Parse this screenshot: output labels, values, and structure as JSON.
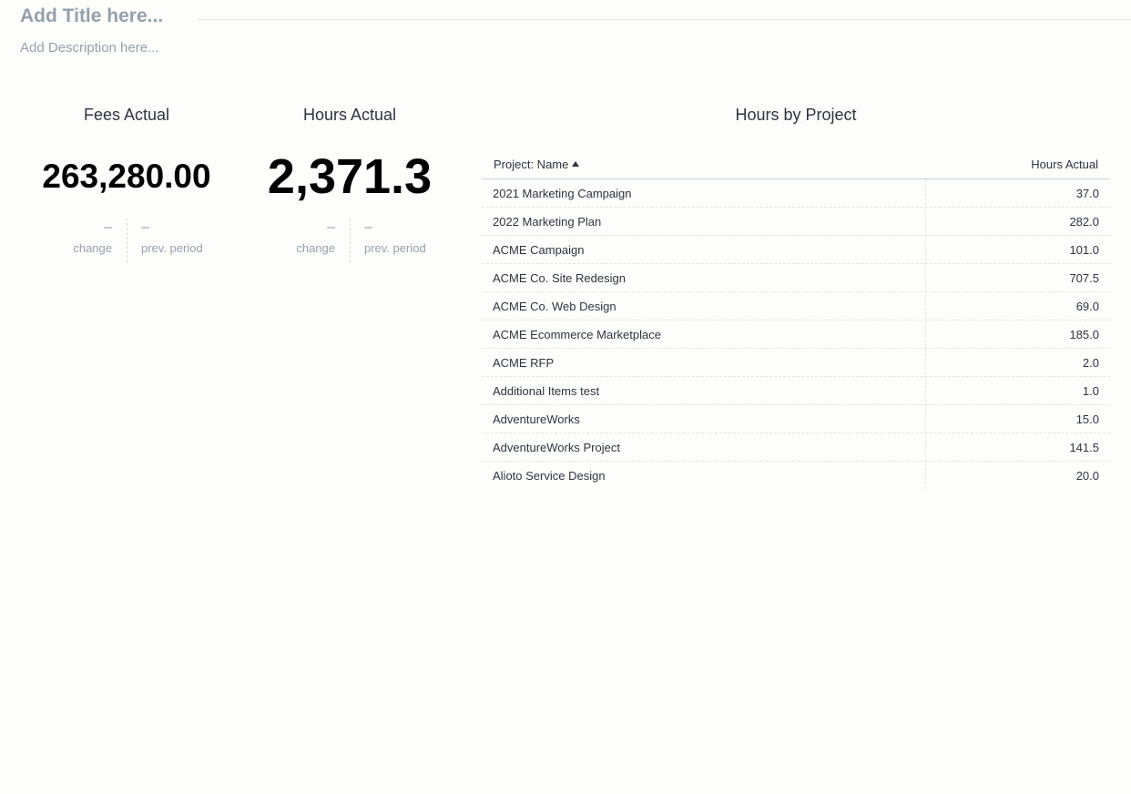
{
  "dashboard": {
    "title_placeholder": "Add Title here...",
    "description_placeholder": "Add Description here..."
  },
  "kpis": [
    {
      "title": "Fees Actual",
      "value": "263,280.00",
      "change_value": "–",
      "change_label": "change",
      "prev_value": "–",
      "prev_label": "prev. period"
    },
    {
      "title": "Hours Actual",
      "value": "2,371.3",
      "change_value": "–",
      "change_label": "change",
      "prev_value": "–",
      "prev_label": "prev. period"
    }
  ],
  "table": {
    "title": "Hours by Project",
    "columns": [
      "Project: Name",
      "Hours Actual"
    ],
    "rows": [
      {
        "name": "2021 Marketing Campaign",
        "value": "37.0"
      },
      {
        "name": "2022 Marketing Plan",
        "value": "282.0"
      },
      {
        "name": "ACME Campaign",
        "value": "101.0"
      },
      {
        "name": "ACME Co. Site Redesign",
        "value": "707.5"
      },
      {
        "name": "ACME Co. Web Design",
        "value": "69.0"
      },
      {
        "name": "ACME Ecommerce Marketplace",
        "value": "185.0"
      },
      {
        "name": "ACME RFP",
        "value": "2.0"
      },
      {
        "name": "Additional Items test",
        "value": "1.0"
      },
      {
        "name": "AdventureWorks",
        "value": "15.0"
      },
      {
        "name": "AdventureWorks Project",
        "value": "141.5"
      },
      {
        "name": "Alioto Service Design",
        "value": "20.0"
      }
    ]
  }
}
